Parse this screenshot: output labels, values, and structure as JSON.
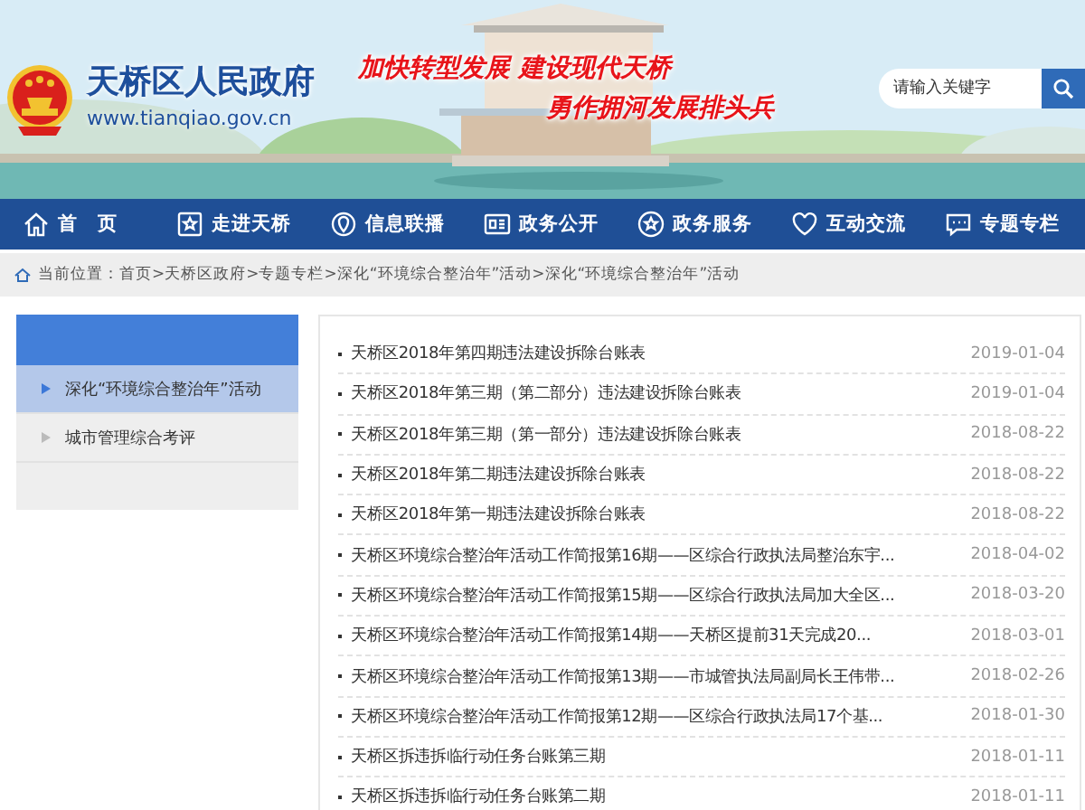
{
  "header": {
    "site_title": "天桥区人民政府",
    "site_url": "www.tianqiao.gov.cn",
    "slogan_lines": [
      "加快转型发展 建设现代天桥",
      "勇作拥河发展排头兵"
    ],
    "search": {
      "placeholder": "请输入关键字"
    }
  },
  "nav": [
    {
      "label": "首　页"
    },
    {
      "label": "走进天桥"
    },
    {
      "label": "信息联播"
    },
    {
      "label": "政务公开"
    },
    {
      "label": "政务服务"
    },
    {
      "label": "互动交流"
    },
    {
      "label": "专题专栏"
    }
  ],
  "breadcrumb": "当前位置：首页>天桥区政府>专题专栏>深化“环境综合整治年”活动>深化“环境综合整治年”活动",
  "sidebar": {
    "items": [
      {
        "label": "深化“环境综合整治年”活动",
        "selected": true
      },
      {
        "label": "城市管理综合考评",
        "selected": false
      }
    ]
  },
  "articles": [
    {
      "title": "天桥区2018年第四期违法建设拆除台账表",
      "date": "2019-01-04"
    },
    {
      "title": "天桥区2018年第三期（第二部分）违法建设拆除台账表",
      "date": "2019-01-04"
    },
    {
      "title": "天桥区2018年第三期（第一部分）违法建设拆除台账表",
      "date": "2018-08-22"
    },
    {
      "title": "天桥区2018年第二期违法建设拆除台账表",
      "date": "2018-08-22"
    },
    {
      "title": "天桥区2018年第一期违法建设拆除台账表",
      "date": "2018-08-22"
    },
    {
      "title": "天桥区环境综合整治年活动工作简报第16期——区综合行政执法局整治东宇...",
      "date": "2018-04-02"
    },
    {
      "title": "天桥区环境综合整治年活动工作简报第15期——区综合行政执法局加大全区...",
      "date": "2018-03-20"
    },
    {
      "title": "天桥区环境综合整治年活动工作简报第14期——天桥区提前31天完成20...",
      "date": "2018-03-01"
    },
    {
      "title": "天桥区环境综合整治年活动工作简报第13期——市城管执法局副局长王伟带...",
      "date": "2018-02-26"
    },
    {
      "title": "天桥区环境综合整治年活动工作简报第12期——区综合行政执法局17个基...",
      "date": "2018-01-30"
    },
    {
      "title": "天桥区拆违拆临行动任务台账第三期",
      "date": "2018-01-11"
    },
    {
      "title": "天桥区拆违拆临行动任务台账第二期",
      "date": "2018-01-11"
    }
  ]
}
